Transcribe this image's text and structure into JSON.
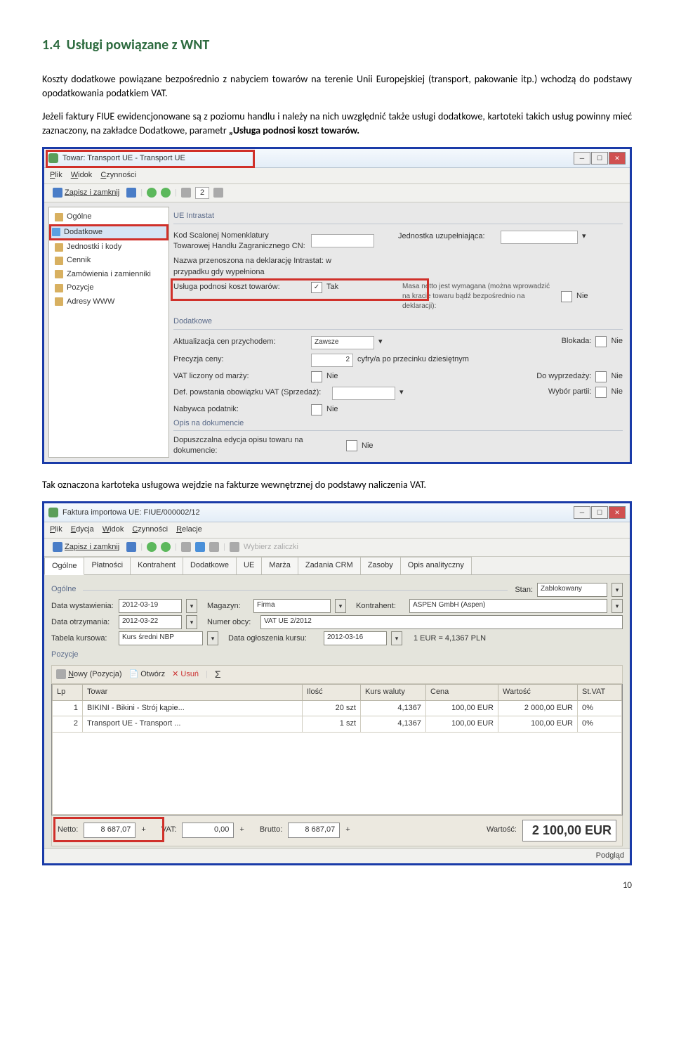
{
  "section": {
    "number": "1.4",
    "title": "Usługi powiązane z WNT"
  },
  "paragraphs": {
    "p1": "Koszty dodatkowe powiązane bezpośrednio z nabyciem towarów na terenie Unii Europejskiej (transport, pakowanie itp.) wchodzą do podstawy opodatkowania podatkiem VAT.",
    "p2a": "Jeżeli faktury FIUE ewidencjonowane są z poziomu handlu i należy na nich uwzględnić także usługi dodatkowe, kartoteki takich usług powinny mieć zaznaczony, na zakładce Dodatkowe, parametr ",
    "p2b": "„Usługa podnosi koszt towarów.",
    "p3": "Tak  oznaczona kartoteka usługowa wejdzie na fakturze wewnętrznej do podstawy naliczenia VAT."
  },
  "win1": {
    "title": "Towar: Transport UE - Transport UE",
    "menu": {
      "plik": "Plik",
      "widok": "Widok",
      "czyn": "Czynności"
    },
    "tb": {
      "save": "Zapisz i zamknij",
      "num": "2"
    },
    "tree": {
      "ogolne": "Ogólne",
      "dodatkowe": "Dodatkowe",
      "jedn": "Jednostki i kody",
      "cennik": "Cennik",
      "zam": "Zamówienia i zamienniki",
      "poz": "Pozycje",
      "adr": "Adresy WWW"
    },
    "grp_intra": "UE Intrastat",
    "rows": {
      "kod_cn": "Kod Scalonej Nomenklatury Towarowej Handlu Zagranicznego CN:",
      "jed_uz": "Jednostka uzupełniająca:",
      "nazwa_dek": "Nazwa przenoszona na deklarację Intrastat: w przypadku gdy wypełniona",
      "usluga": "Usługa podnosi koszt towarów:",
      "tak": "Tak",
      "masa": "Masa netto jest wymagana (można wprowadzić na kracie towaru bądź bezpośrednio na deklaracji):",
      "nie": "Nie"
    },
    "grp_dod": "Dodatkowe",
    "dod": {
      "akt": "Aktualizacja cen przychodem:",
      "akt_v": "Zawsze",
      "blok": "Blokada:",
      "nie": "Nie",
      "prec": "Precyzja ceny:",
      "prec_v": "2",
      "prec_s": "cyfry/a po przecinku dziesiętnym",
      "vatm": "VAT liczony od marży:",
      "wypr": "Do wyprzedaży:",
      "def": "Def. powstania obowiązku VAT (Sprzedaż):",
      "wyb": "Wybór partii:",
      "nab": "Nabywca podatnik:"
    },
    "grp_opis": "Opis na dokumencie",
    "opis": {
      "dop": "Dopuszczalna edycja opisu towaru na dokumencie:",
      "nie": "Nie"
    }
  },
  "win2": {
    "title": "Faktura importowa UE: FIUE/000002/12",
    "menu": {
      "plik": "Plik",
      "edycja": "Edycja",
      "widok": "Widok",
      "czyn": "Czynności",
      "rel": "Relacje"
    },
    "tb": {
      "save": "Zapisz i zamknij",
      "wybierz": "Wybierz zaliczki"
    },
    "tabs": {
      "og": "Ogólne",
      "pl": "Płatności",
      "ko": "Kontrahent",
      "do": "Dodatkowe",
      "ue": "UE",
      "ma": "Marża",
      "za": "Zadania CRM",
      "zs": "Zasoby",
      "oa": "Opis analityczny"
    },
    "grp_og": "Ogólne",
    "stan_l": "Stan:",
    "stan_v": "Zablokowany",
    "rows": {
      "dwyst_l": "Data wystawienia:",
      "dwyst_v": "2012-03-19",
      "mag_l": "Magazyn:",
      "mag_v": "Firma",
      "kon_l": "Kontrahent:",
      "kon_v": "ASPEN GmbH (Aspen)",
      "dotrz_l": "Data otrzymania:",
      "dotrz_v": "2012-03-22",
      "nob_l": "Numer obcy:",
      "nob_v": "VAT UE 2/2012",
      "tab_l": "Tabela kursowa:",
      "tab_v": "Kurs średni NBP",
      "dog_l": "Data ogłoszenia kursu:",
      "dog_v": "2012-03-16",
      "kurs": "1 EUR = 4,1367 PLN"
    },
    "pozycje": "Pozycje",
    "subtb": {
      "nowy": "Nowy (Pozycja)",
      "otw": "Otwórz",
      "usun": "Usuń",
      "sigma": "Σ"
    },
    "cols": {
      "lp": "Lp",
      "tow": "Towar",
      "il": "Ilość",
      "kw": "Kurs waluty",
      "ce": "Cena",
      "wa": "Wartość",
      "sv": "St.VAT"
    },
    "r1": {
      "lp": "1",
      "tow": "BIKINI - Bikini - Strój kąpie...",
      "il": "20 szt",
      "kw": "4,1367",
      "ce": "100,00 EUR",
      "wa": "2 000,00 EUR",
      "sv": "0%"
    },
    "r2": {
      "lp": "2",
      "tow": "Transport UE - Transport ...",
      "il": "1 szt",
      "kw": "4,1367",
      "ce": "100,00 EUR",
      "wa": "100,00 EUR",
      "sv": "0%"
    },
    "totals": {
      "netto_l": "Netto:",
      "netto_v": "8 687,07",
      "vat_l": "VAT:",
      "vat_v": "0,00",
      "brutto_l": "Brutto:",
      "brutto_v": "8 687,07",
      "wart_l": "Wartość:",
      "wart_v": "2 100,00 EUR",
      "plus": "+"
    },
    "status": "Podgląd"
  },
  "pagenum": "10"
}
